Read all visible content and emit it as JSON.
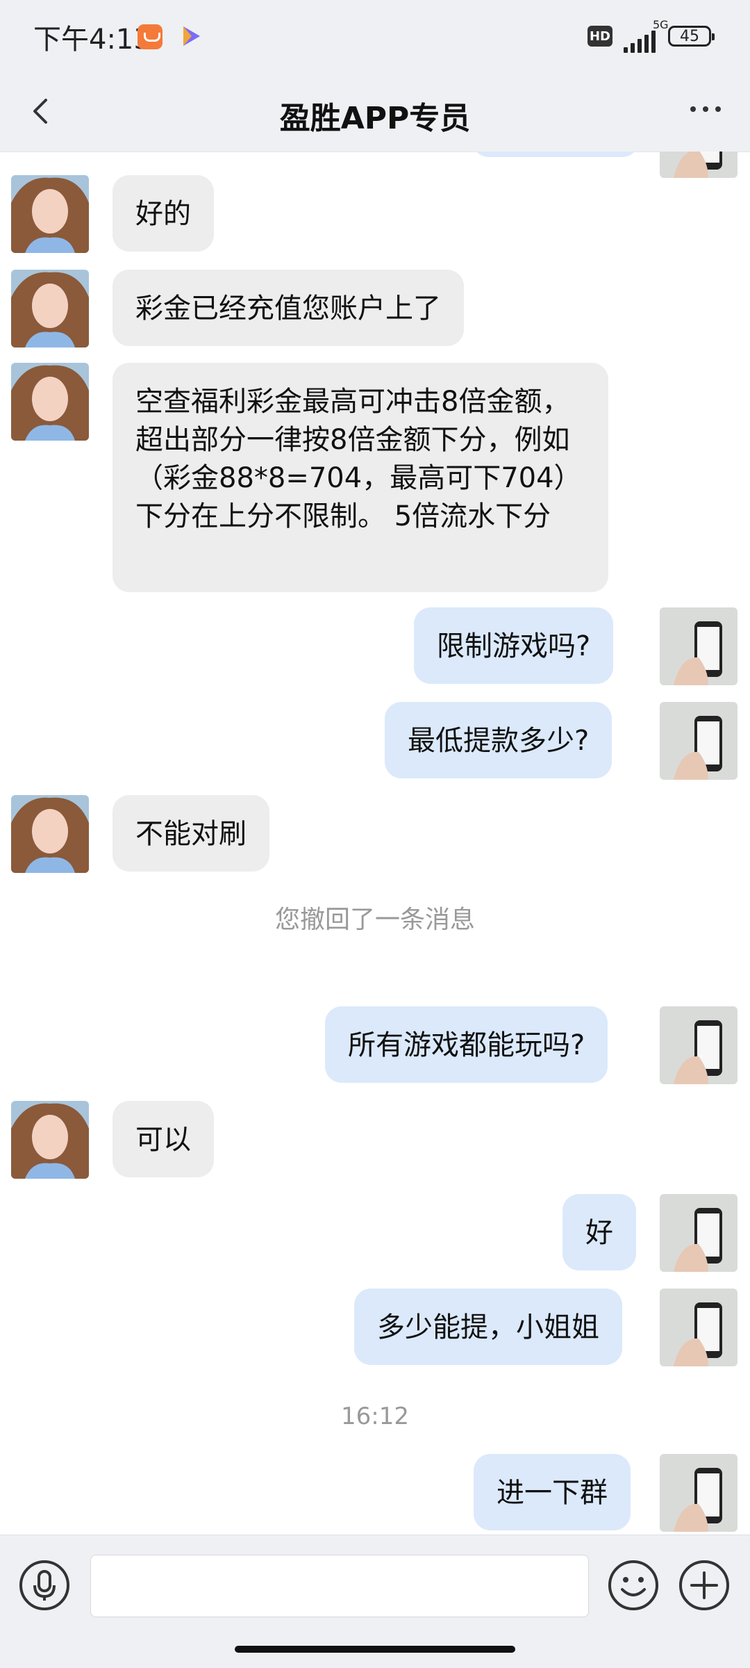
{
  "status_bar": {
    "time": "下午4:13",
    "hd": "HD",
    "network": "5G",
    "battery": "45"
  },
  "header": {
    "title": "盈胜APP专员"
  },
  "messages": [
    {
      "side": "left",
      "text": "好的"
    },
    {
      "side": "left",
      "text": "彩金已经充值您账户上了"
    },
    {
      "side": "left",
      "text": "空查福利彩金最高可冲击8倍金额，超出部分一律按8倍金额下分，例如（彩金88*8=704，最高可下704）下分在上分不限制。 5倍流水下分"
    },
    {
      "side": "right",
      "text": "限制游戏吗?"
    },
    {
      "side": "right",
      "text": "最低提款多少?"
    },
    {
      "side": "left",
      "text": "不能对刷"
    },
    {
      "side": "notice",
      "text": "您撤回了一条消息"
    },
    {
      "side": "right",
      "text": "所有游戏都能玩吗?"
    },
    {
      "side": "left",
      "text": "可以"
    },
    {
      "side": "right",
      "text": "好"
    },
    {
      "side": "right",
      "text": "多少能提，小姐姐"
    },
    {
      "side": "timestamp",
      "text": "16:12"
    },
    {
      "side": "right",
      "text": "进一下群"
    }
  ],
  "composer": {
    "input_value": "",
    "icons": [
      "voice-icon",
      "emoji-icon",
      "plus-icon"
    ]
  },
  "colors": {
    "left_bubble": "#ededed",
    "right_bubble": "#dbe9fb",
    "bar_bg": "#eef0f4"
  }
}
